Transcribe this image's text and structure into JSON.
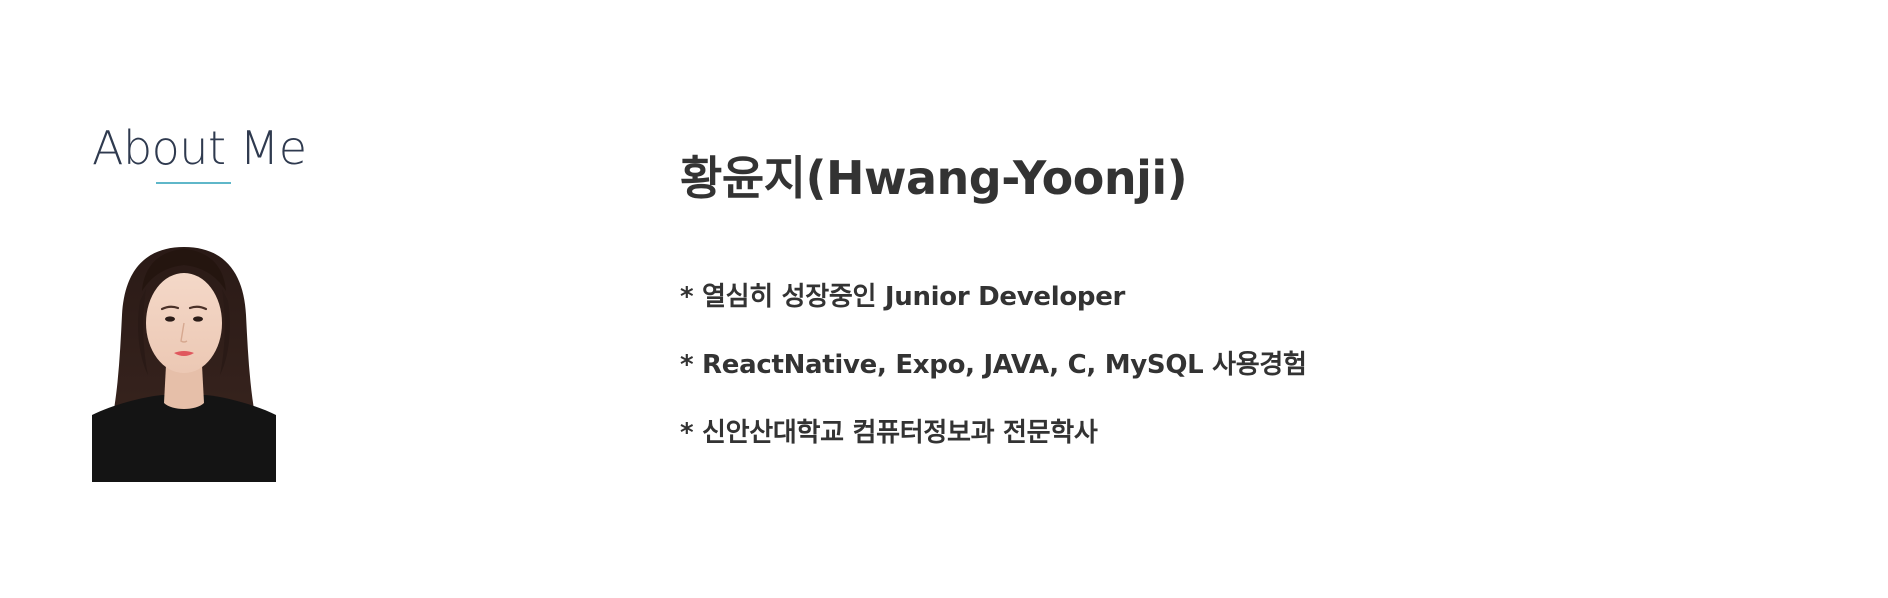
{
  "about": {
    "section_title": "About Me",
    "accent_color": "#5fb7c9",
    "title_color": "#2f3a4f",
    "photo_alt": "profile photo"
  },
  "profile": {
    "name": "황윤지(Hwang-Yoonji)",
    "intro": [
      "* 열심히 성장중인 Junior Developer",
      "* ReactNative, Expo, JAVA, C, MySQL 사용경험",
      "* 신안산대학교 컴퓨터정보과 전문학사"
    ]
  }
}
